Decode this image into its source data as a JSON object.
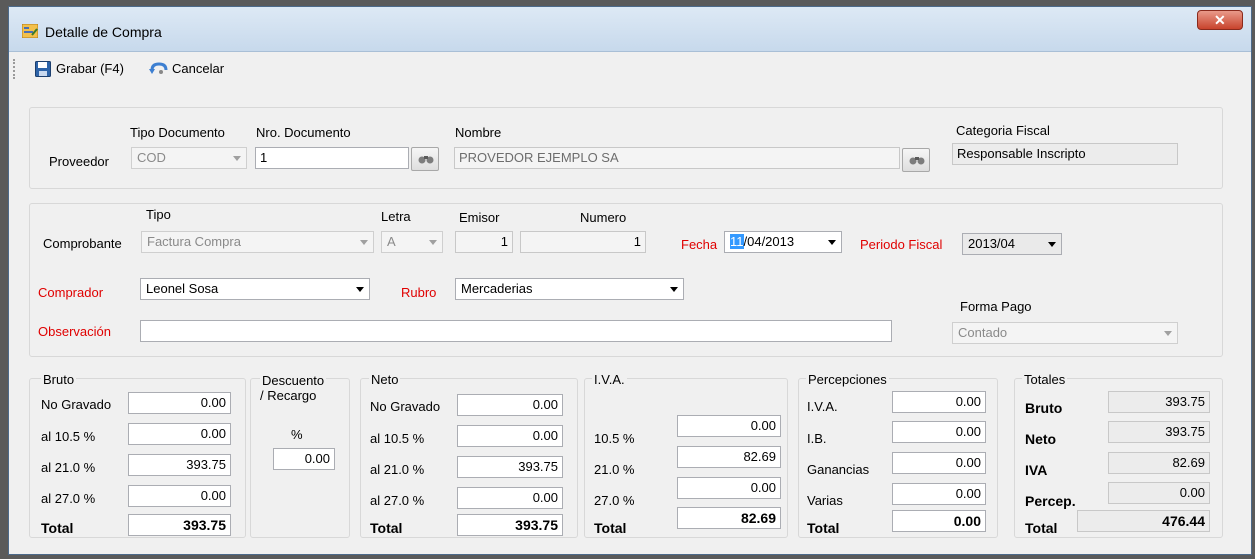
{
  "window": {
    "title": "Detalle de Compra",
    "close_icon": "close-icon",
    "app_icon": "form-icon"
  },
  "toolbar": {
    "save_label": "Grabar (F4)",
    "cancel_label": "Cancelar",
    "save_icon": "floppy-disk-icon",
    "cancel_icon": "undo-icon"
  },
  "proveedor": {
    "label": "Proveedor",
    "tipo_documento": {
      "label": "Tipo Documento",
      "value": "COD"
    },
    "nro_documento": {
      "label": "Nro. Documento",
      "value": "1"
    },
    "nombre": {
      "label": "Nombre",
      "value": "PROVEDOR EJEMPLO SA"
    },
    "categoria_fiscal": {
      "label": "Categoria Fiscal",
      "value": "Responsable Inscripto"
    }
  },
  "comprobante": {
    "label": "Comprobante",
    "tipo": {
      "label": "Tipo",
      "value": "Factura Compra"
    },
    "letra": {
      "label": "Letra",
      "value": "A"
    },
    "emisor": {
      "label": "Emisor",
      "value": "1"
    },
    "numero": {
      "label": "Numero",
      "value": "1"
    },
    "fecha": {
      "label": "Fecha",
      "day_selected": "11",
      "rest": "/04/2013"
    },
    "periodo_fiscal": {
      "label": "Periodo Fiscal",
      "value": "2013/04"
    },
    "comprador": {
      "label": "Comprador",
      "value": "Leonel Sosa"
    },
    "rubro": {
      "label": "Rubro",
      "value": "Mercaderias"
    },
    "observacion": {
      "label": "Observación",
      "value": ""
    },
    "forma_pago": {
      "label": "Forma Pago",
      "value": "Contado"
    }
  },
  "bruto": {
    "title": "Bruto",
    "rows": [
      {
        "label": "No Gravado",
        "value": "0.00"
      },
      {
        "label": "al 10.5 %",
        "value": "0.00"
      },
      {
        "label": "al 21.0 %",
        "value": "393.75"
      },
      {
        "label": "al 27.0 %",
        "value": "0.00"
      }
    ],
    "total_label": "Total",
    "total": "393.75"
  },
  "descuento": {
    "title": "Descuento",
    "title2": "/ Recargo",
    "pct_label": "%",
    "value": "0.00"
  },
  "neto": {
    "title": "Neto",
    "rows": [
      {
        "label": "No Gravado",
        "value": "0.00"
      },
      {
        "label": "al 10.5 %",
        "value": "0.00"
      },
      {
        "label": "al 21.0 %",
        "value": "393.75"
      },
      {
        "label": "al 27.0 %",
        "value": "0.00"
      }
    ],
    "total_label": "Total",
    "total": "393.75"
  },
  "iva": {
    "title": "I.V.A.",
    "rows": [
      {
        "label": "10.5 %",
        "value": "0.00"
      },
      {
        "label": "21.0 %",
        "value": "82.69"
      },
      {
        "label": "27.0 %",
        "value": "0.00"
      }
    ],
    "total_label": "Total",
    "total": "82.69"
  },
  "percepciones": {
    "title": "Percepciones",
    "rows": [
      {
        "label": "I.V.A.",
        "value": "0.00"
      },
      {
        "label": "I.B.",
        "value": "0.00"
      },
      {
        "label": "Ganancias",
        "value": "0.00"
      },
      {
        "label": "Varias",
        "value": "0.00"
      }
    ],
    "total_label": "Total",
    "total": "0.00"
  },
  "totales": {
    "title": "Totales",
    "rows": [
      {
        "label": "Bruto",
        "value": "393.75"
      },
      {
        "label": "Neto",
        "value": "393.75"
      },
      {
        "label": "IVA",
        "value": "82.69"
      },
      {
        "label": "Percep.",
        "value": "0.00"
      }
    ],
    "total_label": "Total",
    "total": "476.44"
  }
}
